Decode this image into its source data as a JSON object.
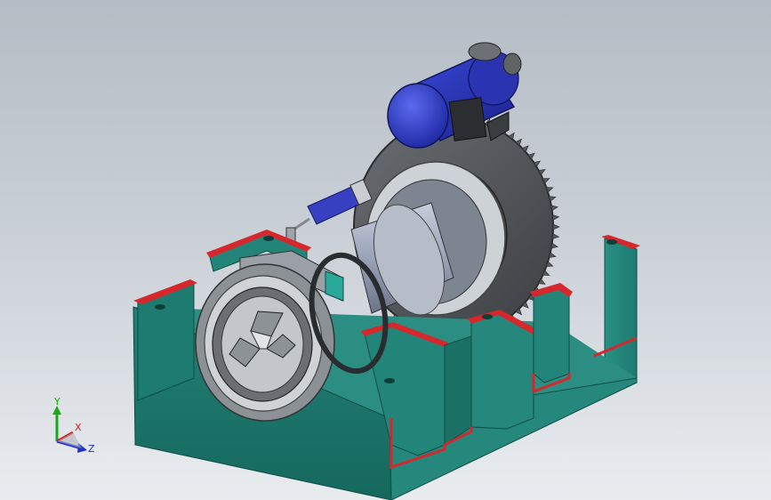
{
  "view": {
    "background_top": "#b4bcc5",
    "background_bottom": "#e9ecef"
  },
  "model": {
    "components": [
      {
        "name": "base-frame",
        "color": "#1f8074"
      },
      {
        "name": "section-cut-face",
        "color": "#d6282c"
      },
      {
        "name": "drive-motor",
        "color": "#2c38c8"
      },
      {
        "name": "ring-gear",
        "color": "#55585b"
      },
      {
        "name": "rotating-drum",
        "color": "#9aa4b8"
      },
      {
        "name": "three-jaw-chuck",
        "color": "#b8bcc2"
      },
      {
        "name": "pneumatic-cylinder",
        "color": "#3640c0"
      },
      {
        "name": "sensor-bracket",
        "color": "#2aa89a"
      }
    ]
  },
  "triad": {
    "x_label": "X",
    "y_label": "Y",
    "z_label": "Z",
    "x_color": "#d42020",
    "y_color": "#18a818",
    "z_color": "#2030d0"
  }
}
